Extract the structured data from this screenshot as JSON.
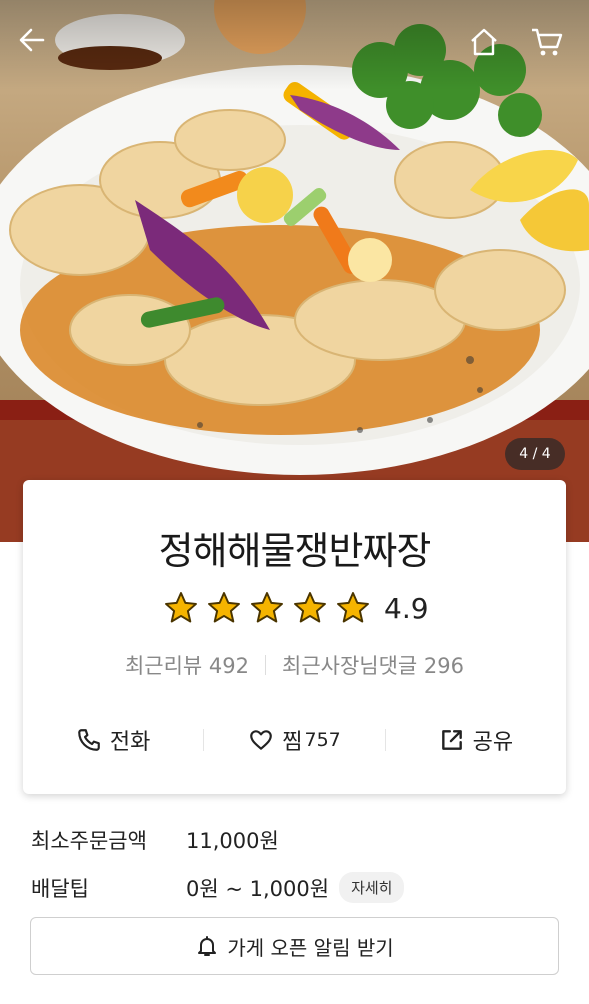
{
  "nav": {
    "back_icon": "arrow-left-icon",
    "home_icon": "home-icon",
    "cart_icon": "cart-icon"
  },
  "hero": {
    "photo_counter": "4 / 4"
  },
  "store": {
    "name": "정해해물쟁반짜장",
    "rating": "4.9",
    "stars": 5,
    "recent_reviews": "최근리뷰 492",
    "recent_owner_replies": "최근사장님댓글 296"
  },
  "actions": {
    "call_label": "전화",
    "favorite_label": "찜",
    "favorite_count": "757",
    "share_label": "공유"
  },
  "order_info": {
    "min_order_label": "최소주문금액",
    "min_order_value": "11,000원",
    "delivery_tip_label": "배달팁",
    "delivery_tip_value": "0원 ~ 1,000원",
    "detail_label": "자세히"
  },
  "notify": {
    "label": "가게 오픈 알림 받기"
  },
  "colors": {
    "star": "#f5b400",
    "accent_text": "#222222",
    "muted_text": "#888888"
  }
}
